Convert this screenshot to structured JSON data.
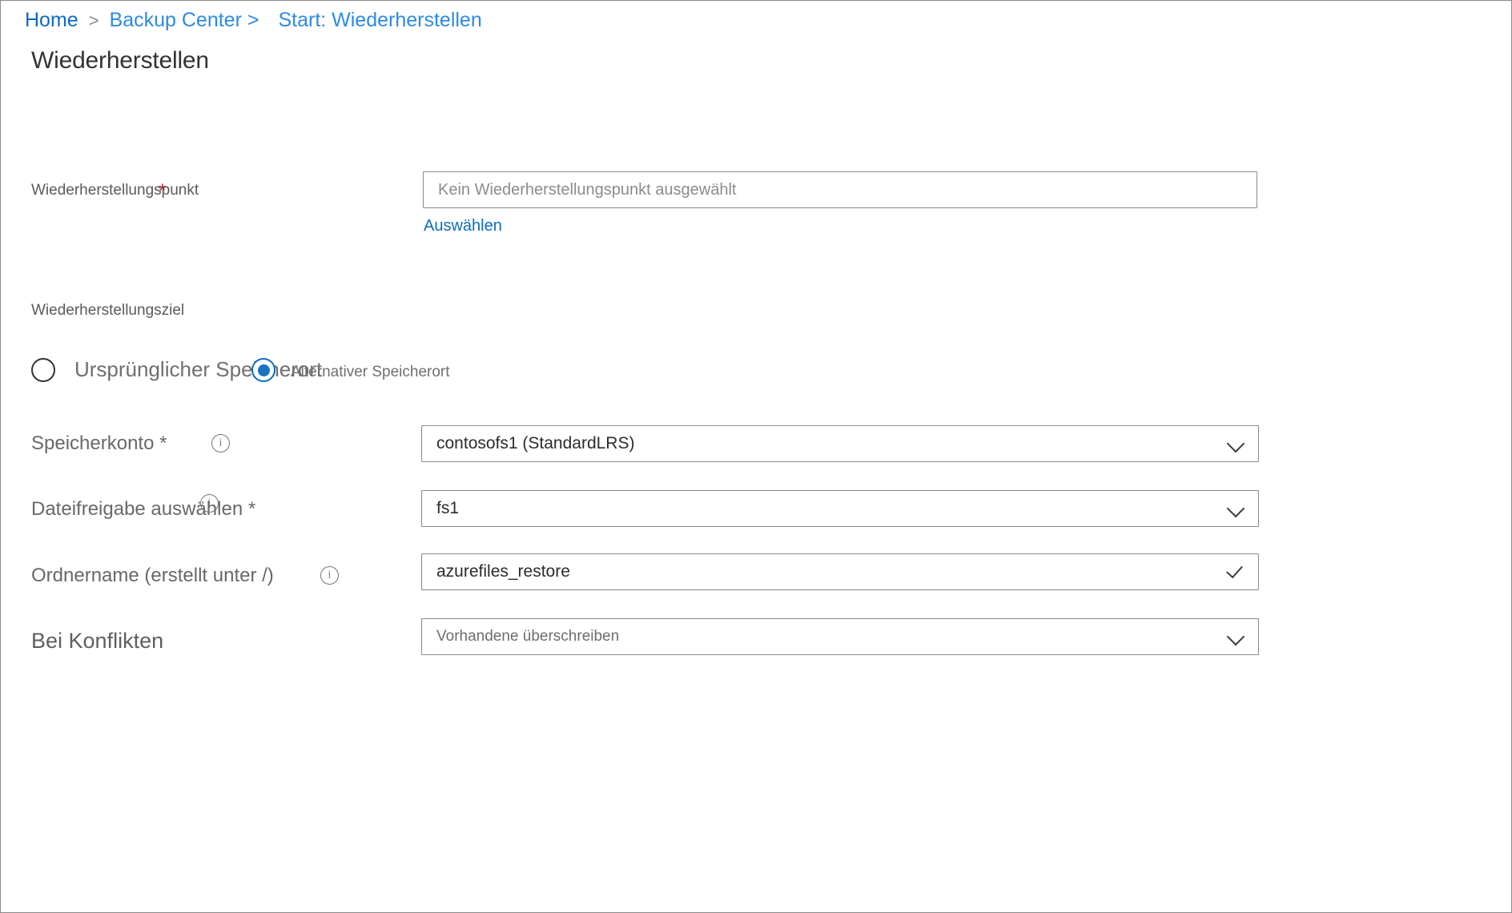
{
  "breadcrumb": {
    "items": [
      {
        "label": "Home",
        "name": "breadcrumb-home"
      },
      {
        "label": "Backup Center >",
        "name": "breadcrumb-backup-center"
      },
      {
        "label": "Start: Wiederherstellen",
        "name": "breadcrumb-start-restore"
      }
    ],
    "separator": ">"
  },
  "page": {
    "title": "Wiederherstellen"
  },
  "restore_point": {
    "label": "Wiederherstellungspunkt",
    "required_marker": "*",
    "input_placeholder": "Kein Wiederherstellungspunkt ausgewählt",
    "select_link": "Auswählen"
  },
  "restore_destination": {
    "section_label": "Wiederherstellungsziel",
    "options": [
      {
        "label": "Ursprünglicher Speicherort",
        "selected": false
      },
      {
        "label": "Alternativer Speicherort",
        "selected": true
      }
    ]
  },
  "fields": {
    "storage_account": {
      "label": "Speicherkonto *",
      "value": "contosofs1 (StandardLRS)",
      "icon": "chevron-down-icon",
      "info_icon": "info-icon"
    },
    "file_share": {
      "label": "Dateifreigabe auswählen *",
      "value": "fs1",
      "icon": "chevron-down-icon",
      "info_icon": "info-icon"
    },
    "folder_name": {
      "label": "Ordnername (erstellt unter /)",
      "value": "azurefiles_restore",
      "icon": "checkmark-icon",
      "info_icon": "info-icon"
    },
    "on_conflict": {
      "label": "Bei Konflikten",
      "value": "Vorhandene überschreiben",
      "icon": "chevron-down-icon"
    }
  },
  "colors": {
    "link_blue": "#0f6cbd",
    "accent_blue": "#1a72c1",
    "required_red": "#a4262c",
    "label_gray": "#696969",
    "border_gray": "#8a8a8a"
  }
}
